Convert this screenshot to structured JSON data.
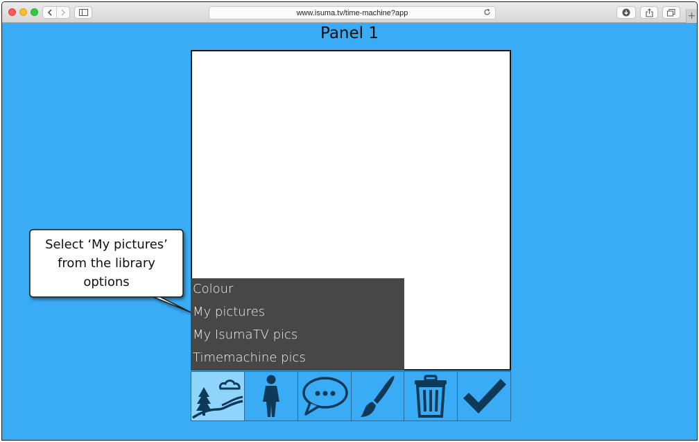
{
  "browser": {
    "url": "www.isuma.tv/time-machine?app",
    "icons": {
      "back": "chevron-left-icon",
      "forward": "chevron-right-icon",
      "sidebar": "sidebar-icon",
      "reload": "reload-icon",
      "downloads": "download-icon",
      "share": "share-icon",
      "tabs": "tabs-icon",
      "new_tab": "plus-icon"
    }
  },
  "page": {
    "title": "Panel 1",
    "background_color": "#3aabf5"
  },
  "library_menu": {
    "items": [
      {
        "label": "Colour"
      },
      {
        "label": "My pictures"
      },
      {
        "label": "My IsumaTV pics"
      },
      {
        "label": "Timemachine pics"
      }
    ]
  },
  "tools": [
    {
      "icon": "background-landscape-icon",
      "active": true
    },
    {
      "icon": "character-person-icon",
      "active": false
    },
    {
      "icon": "speech-bubble-icon",
      "active": false
    },
    {
      "icon": "paintbrush-icon",
      "active": false
    },
    {
      "icon": "trash-can-icon",
      "active": false
    },
    {
      "icon": "checkmark-icon",
      "active": false
    }
  ],
  "callout": {
    "line1": "Select ‘My pictures’",
    "line2": "from the library",
    "line3": "options"
  }
}
